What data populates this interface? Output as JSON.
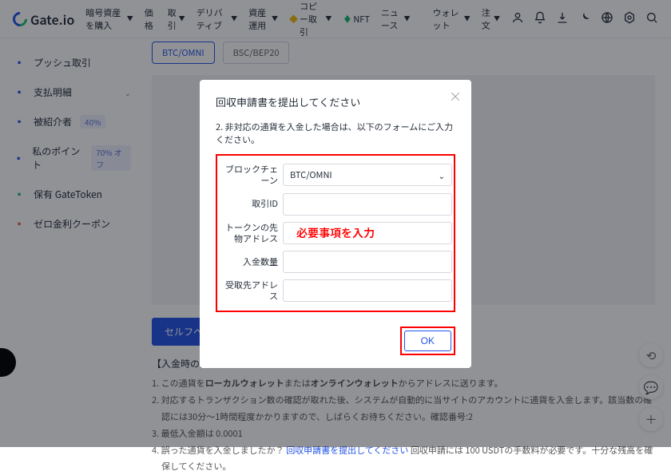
{
  "logo": "Gate.io",
  "topnav": [
    {
      "label": "暗号資産を購入",
      "dd": true
    },
    {
      "label": "価格",
      "dd": false
    },
    {
      "label": "取引",
      "dd": true
    },
    {
      "label": "デリバティブ",
      "dd": true
    },
    {
      "label": "資産運用",
      "dd": true
    },
    {
      "label": "コピー取引",
      "dd": true,
      "copy": true
    },
    {
      "label": "NFT",
      "dd": false,
      "nft": true
    },
    {
      "label": "ニュース",
      "dd": true
    }
  ],
  "topright": {
    "wallet": "ウォレット",
    "orders": "注文"
  },
  "sidebar": {
    "items": [
      {
        "label": "プッシュ取引",
        "icon": "push"
      },
      {
        "label": "支払明細",
        "icon": "stmt",
        "chev": true
      },
      {
        "label": "被紹介者",
        "icon": "ref",
        "badge": "40%"
      },
      {
        "label": "私のポイント",
        "icon": "pts",
        "badge": "70% オフ"
      },
      {
        "label": "保有 GateToken",
        "icon": "gt"
      },
      {
        "label": "ゼロ金利クーポン",
        "icon": "coupon"
      }
    ]
  },
  "tabs": [
    "BTC/OMNI",
    "BSC/BEP20"
  ],
  "bluebtn": "セルフヘルプアク",
  "notes_title": "【入金時の注意事項】",
  "notes": [
    "1. この通貨をローカルウォレットまたはオンラインウォレットからアドレスに送ります。",
    "2. 対応するトランザクション数の確認が取れた後、システムが自動的に当サイトのアカウントに通貨を入金します。該当数の確認には30分～1時間程度かかりますので、しばらくお待ちください。確認番号:2",
    "3. 最低入金額は 0.0001",
    "4. 誤った通貨を入金しましたか？ 回収申請書を提出してください 回収申請には 100 USDTの手数料が必要です。十分な残高を確保してください。"
  ],
  "note4_link": "回収申請書を提出してください",
  "modal": {
    "title": "回収申請書を提出してください",
    "subtitle": "2. 非対応の通貨を入金した場合は、以下のフォームにご入力ください。",
    "fields": {
      "blockchain_label": "ブロックチェーン",
      "blockchain_value": "BTC/OMNI",
      "txid_label": "取引ID",
      "token_addr_label": "トークンの先物アドレス",
      "amount_label": "入金数量",
      "recv_addr_label": "受取先アドレス"
    },
    "annotation": "必要事項を入力",
    "ok": "OK"
  }
}
